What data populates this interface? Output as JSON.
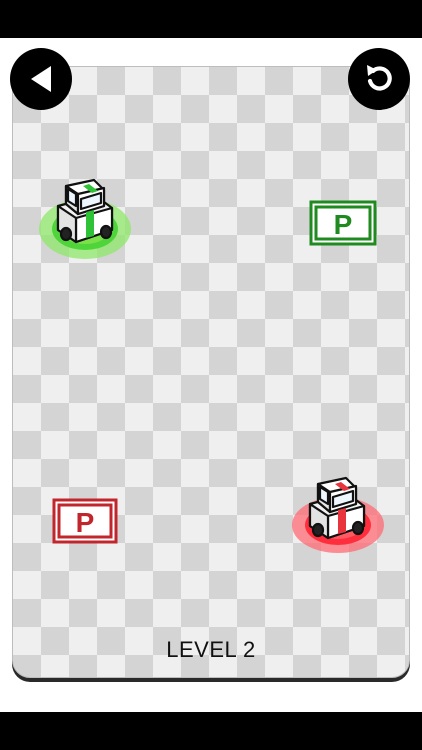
{
  "hud": {
    "back_icon": "back-triangle-icon",
    "restart_icon": "restart-arrow-icon"
  },
  "level": {
    "label": "LEVEL 2"
  },
  "parking_spots": [
    {
      "color": "green",
      "letter": "P",
      "stroke": "#1f8a1f"
    },
    {
      "color": "red",
      "letter": "P",
      "stroke": "#c0262b"
    }
  ],
  "cars": [
    {
      "color": "green",
      "ring": "#7be04a",
      "stripe": "#2fc236"
    },
    {
      "color": "red",
      "ring": "#ff3b4a",
      "stripe": "#e8343c"
    }
  ],
  "colors": {
    "board_light": "#efefef",
    "board_dark": "#d4d4d4",
    "frame": "#000000"
  }
}
